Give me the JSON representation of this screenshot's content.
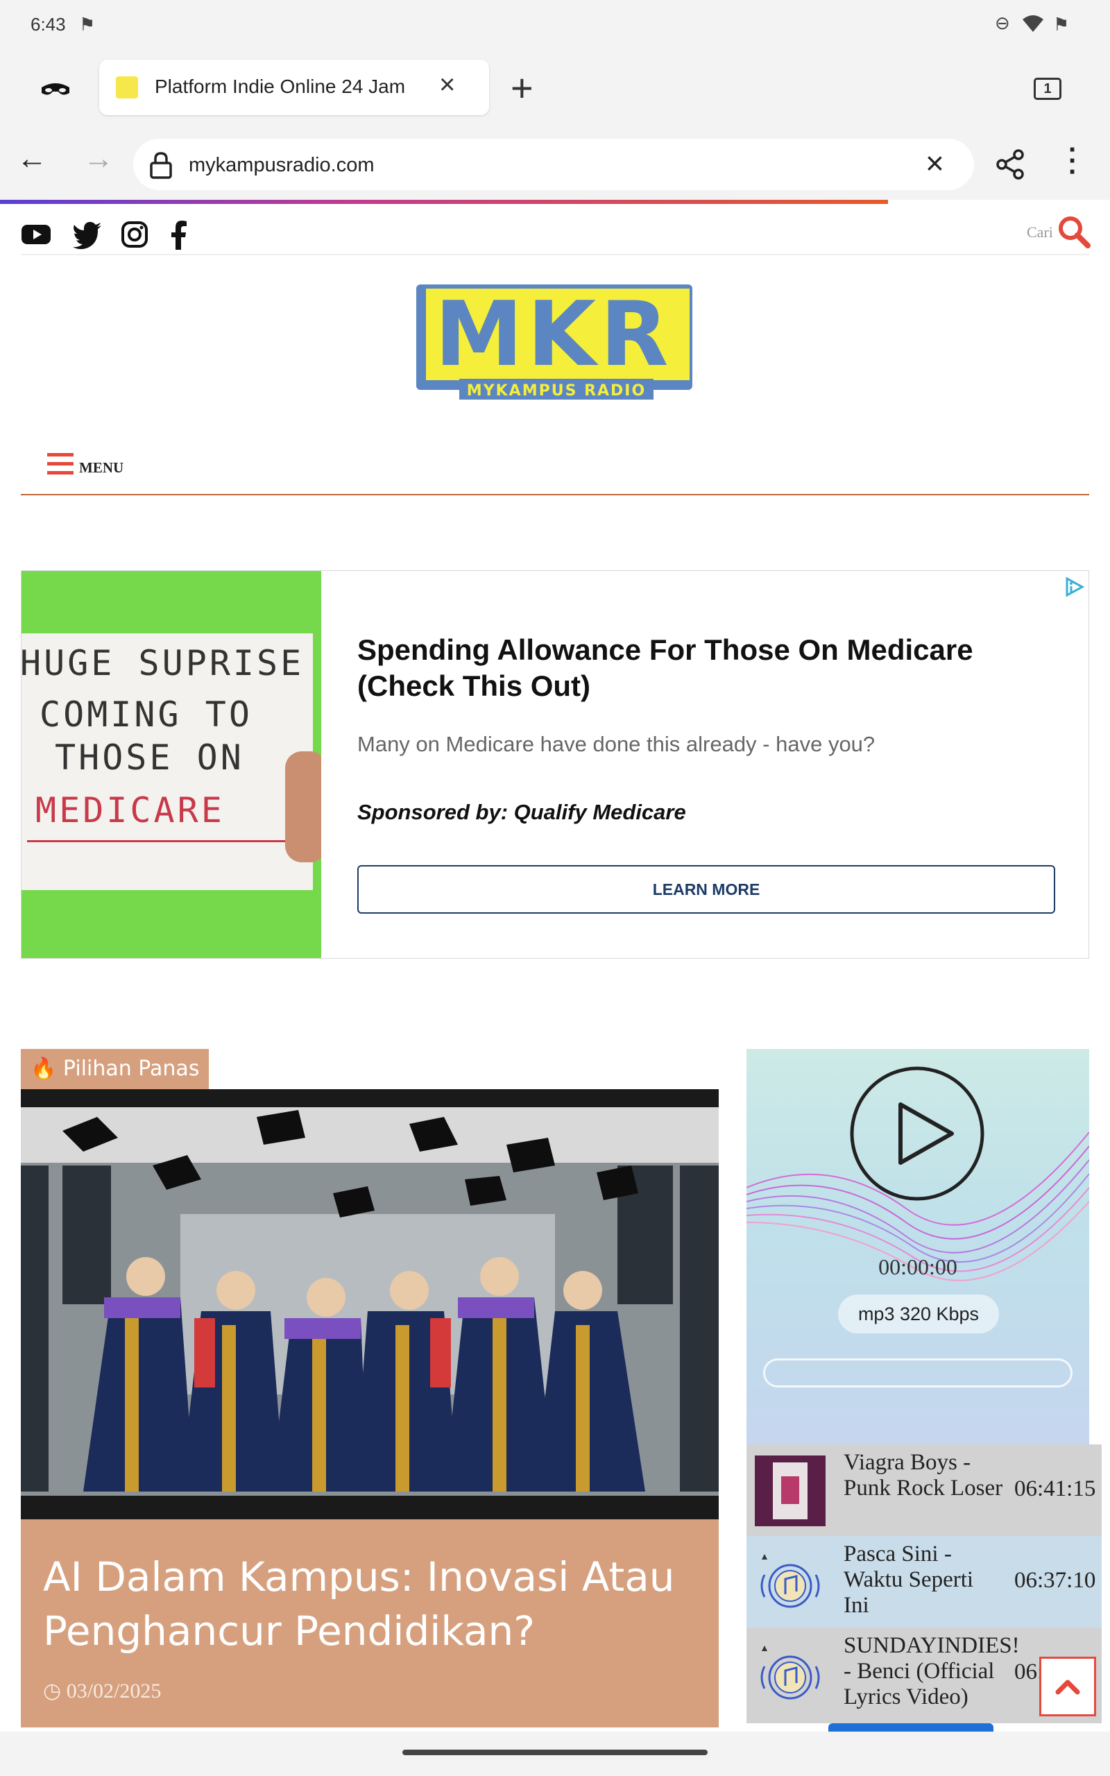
{
  "status_bar": {
    "time": "6:43"
  },
  "browser": {
    "tab_title": "Platform Indie Online 24 Jam",
    "tab_count": "1",
    "url": "mykampusradio.com"
  },
  "site": {
    "search_label": "Cari",
    "logo_text": "MKR",
    "logo_subtext": "MYKAMPUS RADIO",
    "menu_label": "MENU"
  },
  "ad": {
    "image_lines": [
      "HUGE SUPRISE",
      "COMING TO",
      "THOSE ON",
      "MEDICARE"
    ],
    "title": "Spending Allowance For Those On Medicare (Check This Out)",
    "description": "Many on Medicare have done this already - have you?",
    "sponsor": "Sponsored by: Qualify Medicare",
    "cta": "LEARN MORE"
  },
  "featured": {
    "badge": "Pilihan Panas",
    "title": "AI Dalam Kampus: Inovasi Atau Penghancur Pendidikan?",
    "date": "03/02/2025"
  },
  "player": {
    "time": "00:00:00",
    "bitrate": "mp3 320 Kbps",
    "tracks": [
      {
        "title": "Viagra Boys - Punk Rock Loser",
        "time": "06:41:15"
      },
      {
        "title": "Pasca Sini - Waktu Seperti Ini",
        "time": "06:37:10"
      },
      {
        "title": "SUNDAYINDIES! - Benci (Official Lyrics Video)",
        "time": "06:3?:?7"
      }
    ]
  },
  "colors": {
    "accent": "#c0663a",
    "badge": "#d6a07e",
    "search": "#e44a3c",
    "cta_border": "#1c3c66"
  }
}
